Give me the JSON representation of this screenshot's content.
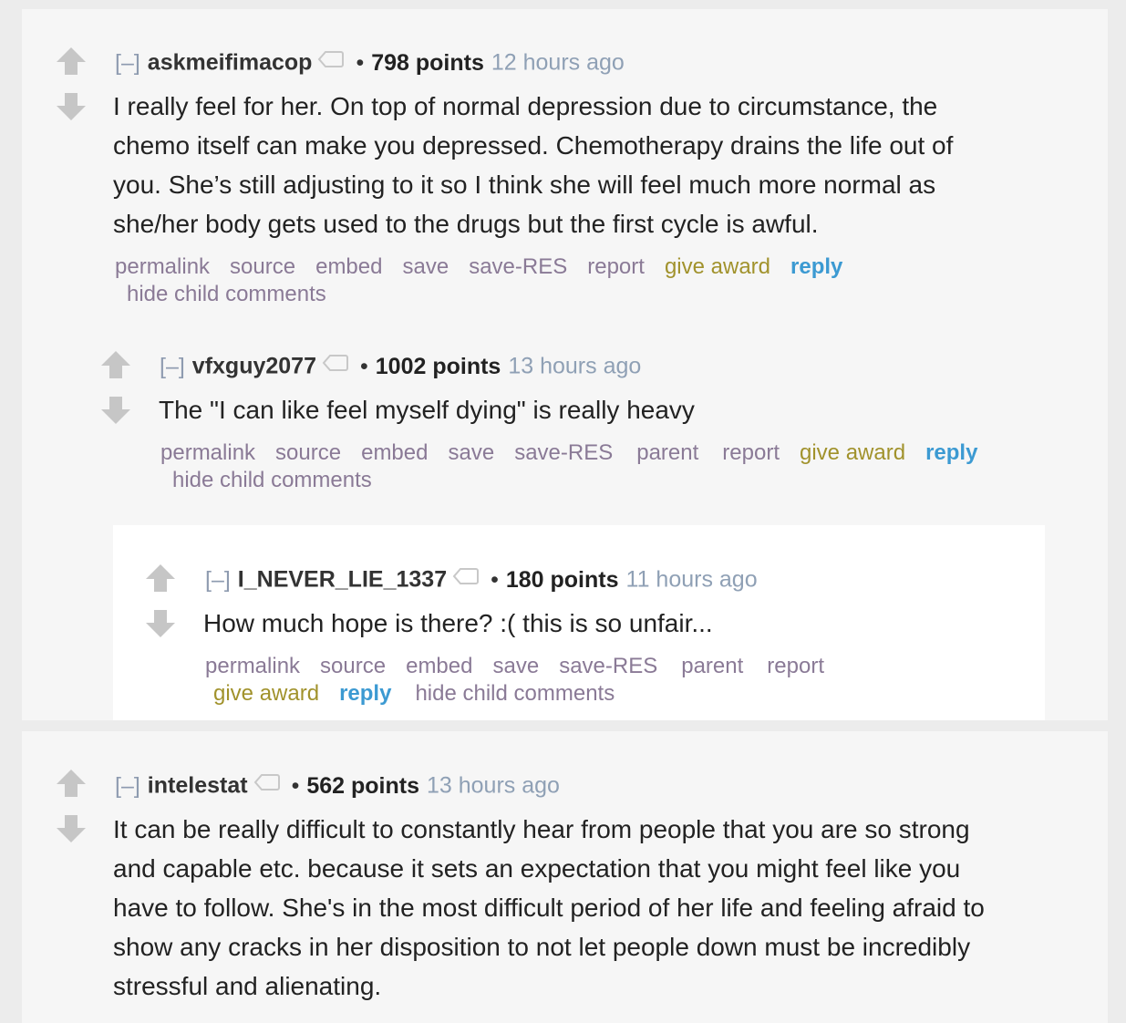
{
  "comments": [
    {
      "expand": "[–]",
      "author": "askmeifimacop",
      "score": "798 points",
      "time": "12 hours ago",
      "body": [
        "I really feel for her. On top of normal depression due to circumstance, the",
        "chemo itself can make you depressed. Chemotherapy drains the life out of",
        "you. She’s still adjusting to it so I think she will feel much more normal as",
        "she/her body gets used to the drugs but the first cycle is awful."
      ],
      "buttons": {
        "permalink": "permalink",
        "source": "source",
        "embed": "embed",
        "save": "save",
        "save_res": "save-RES",
        "report": "report",
        "give_award": "give award",
        "reply": "reply",
        "hide": "hide child comments"
      }
    },
    {
      "expand": "[–]",
      "author": "vfxguy2077",
      "score": "1002 points",
      "time": "13 hours ago",
      "body": [
        "The \"I can like feel myself dying\" is really heavy"
      ],
      "buttons": {
        "permalink": "permalink",
        "source": "source",
        "embed": "embed",
        "save": "save",
        "save_res": "save-RES",
        "parent": "parent",
        "report": "report",
        "give_award": "give award",
        "reply": "reply",
        "hide": "hide child comments"
      }
    },
    {
      "expand": "[–]",
      "author": "I_NEVER_LIE_1337",
      "score": "180 points",
      "time": "11 hours ago",
      "body": [
        "How much hope is there? :( this is so unfair..."
      ],
      "buttons": {
        "permalink": "permalink",
        "source": "source",
        "embed": "embed",
        "save": "save",
        "save_res": "save-RES",
        "parent": "parent",
        "report": "report",
        "give_award": "give award",
        "reply": "reply",
        "hide": "hide child comments"
      }
    },
    {
      "expand": "[–]",
      "author": "intelestat",
      "score": "562 points",
      "time": "13 hours ago",
      "body": [
        "It can be really difficult to constantly hear from people that you are so strong",
        "and capable etc. because it sets an expectation that you might feel like you",
        "have to follow. She's in the most difficult period of her life and feeling afraid to",
        "show any cracks in her disposition to not let people down must be incredibly",
        "stressful and alienating."
      ]
    }
  ],
  "icons": {
    "upvote": "upvote-arrow-icon",
    "downvote": "downvote-arrow-icon",
    "tag": "user-tag-icon"
  },
  "colors": {
    "page_bg": "#ececec",
    "comment_bg": "#f6f6f6",
    "nested_bg": "#ffffff",
    "arrow": "#c6c6c6",
    "link": "#8a7a96",
    "award": "#a1922c",
    "reply": "#3c9ad2",
    "time": "#8fa0b5",
    "expand": "#8e9bb0"
  }
}
